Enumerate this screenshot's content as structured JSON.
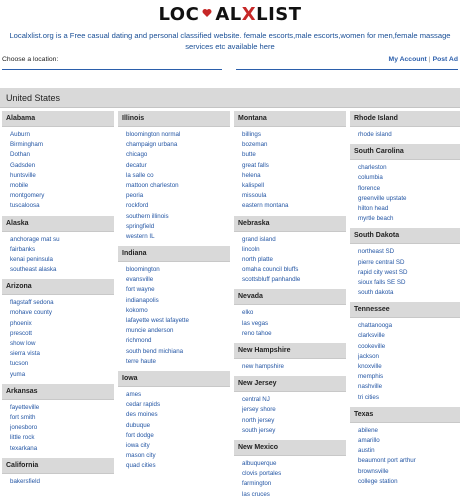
{
  "logo": {
    "part1": "LOC",
    "part2": "AL",
    "part3": "X",
    "part4": "LIST"
  },
  "tagline": "Localxlist.org is a Free casual dating and personal classified website. female escorts,male escorts,women for men,female massage services etc available here",
  "location_label": "Choose a location:",
  "account": {
    "my_account": "My Account",
    "separator": "|",
    "post_ad": "Post Ad"
  },
  "country": "United States",
  "columns": [
    [
      {
        "state": "Alabama",
        "cities": [
          "Auburn",
          "Birmingham",
          "Dothan",
          "Gadsden",
          "huntsville",
          "mobile",
          "montgomery",
          "tuscaloosa"
        ]
      },
      {
        "state": "Alaska",
        "cities": [
          "anchorage mat su",
          "fairbanks",
          "kenai peninsula",
          "southeast alaska"
        ]
      },
      {
        "state": "Arizona",
        "cities": [
          "flagstaff sedona",
          "mohave county",
          "phoenix",
          "prescott",
          "show low",
          "sierra vista",
          "tucson",
          "yuma"
        ]
      },
      {
        "state": "Arkansas",
        "cities": [
          "fayetteville",
          "fort smith",
          "jonesboro",
          "little rock",
          "texarkana"
        ]
      },
      {
        "state": "California",
        "cities": [
          "bakersfield"
        ]
      }
    ],
    [
      {
        "state": "Illinois",
        "cities": [
          "bloomington normal",
          "champaign urbana",
          "chicago",
          "decatur",
          "la salle co",
          "mattoon charleston",
          "peoria",
          "rockford",
          "southern illinois",
          "springfield",
          "western IL"
        ]
      },
      {
        "state": "Indiana",
        "cities": [
          "bloomington",
          "evansville",
          "fort wayne",
          "indianapolis",
          "kokomo",
          "lafayette west lafayette",
          "muncie anderson",
          "richmond",
          "south bend michiana",
          "terre haute"
        ]
      },
      {
        "state": "Iowa",
        "cities": [
          "ames",
          "cedar rapids",
          "des moines",
          "dubuque",
          "fort dodge",
          "iowa city",
          "mason city",
          "quad cities"
        ]
      }
    ],
    [
      {
        "state": "Montana",
        "cities": [
          "billings",
          "bozeman",
          "butte",
          "great falls",
          "helena",
          "kalispell",
          "missoula",
          "eastern montana"
        ]
      },
      {
        "state": "Nebraska",
        "cities": [
          "grand island",
          "lincoln",
          "north platte",
          "omaha council bluffs",
          "scottsbluff panhandle"
        ]
      },
      {
        "state": "Nevada",
        "cities": [
          "elko",
          "las vegas",
          "reno tahoe"
        ]
      },
      {
        "state": "New Hampshire",
        "cities": [
          "new hampshire"
        ]
      },
      {
        "state": "New Jersey",
        "cities": [
          "central NJ",
          "jersey shore",
          "north jersey",
          "south jersey"
        ]
      },
      {
        "state": "New Mexico",
        "cities": [
          "albuquerque",
          "clovis portales",
          "farmington",
          "las cruces"
        ]
      }
    ],
    [
      {
        "state": "Rhode Island",
        "cities": [
          "rhode island"
        ]
      },
      {
        "state": "South Carolina",
        "cities": [
          "charleston",
          "columbia",
          "florence",
          "greenville upstate",
          "hilton head",
          "myrtle beach"
        ]
      },
      {
        "state": "South Dakota",
        "cities": [
          "northeast SD",
          "pierre central SD",
          "rapid city west SD",
          "sioux falls SE SD",
          "south dakota"
        ]
      },
      {
        "state": "Tennessee",
        "cities": [
          "chattanooga",
          "clarksville",
          "cookeville",
          "jackson",
          "knoxville",
          "memphis",
          "nashville",
          "tri cities"
        ]
      },
      {
        "state": "Texas",
        "cities": [
          "abilene",
          "amarillo",
          "austin",
          "beaumont port arthur",
          "brownsville",
          "college station"
        ]
      }
    ]
  ]
}
